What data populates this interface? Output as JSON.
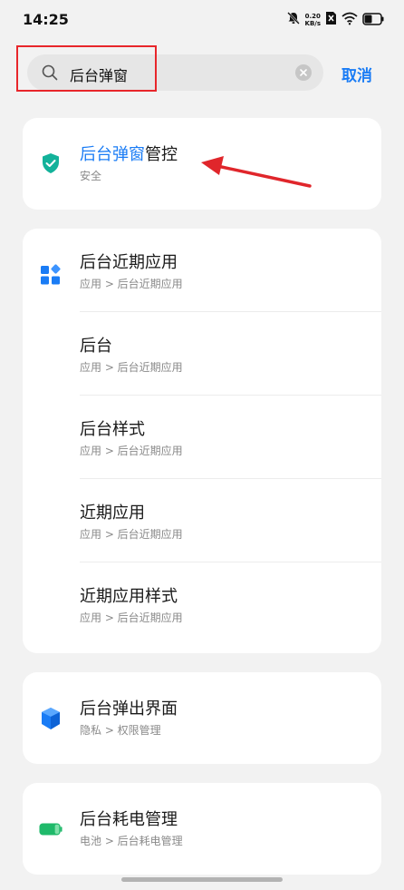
{
  "status_bar": {
    "time": "14:25",
    "net_speed_value": "0.20",
    "net_speed_unit": "KB/s",
    "icons": [
      "bell-off-icon",
      "net-speed",
      "sim-icon",
      "wifi-icon",
      "battery-icon"
    ]
  },
  "search": {
    "query": "后台弹窗",
    "clear_icon": "clear-icon",
    "cancel_label": "取消"
  },
  "results": [
    {
      "title_highlight": "后台弹窗",
      "title_rest": "管控",
      "subtitle": "安全",
      "icon": "shield-check-icon",
      "icon_color": "#13b29a"
    },
    {
      "group": [
        {
          "title": "后台近期应用",
          "subtitle": "应用 > 后台近期应用",
          "icon": "apps-grid-icon",
          "icon_color": "#1a7cf5"
        },
        {
          "title": "后台",
          "subtitle": "应用 > 后台近期应用"
        },
        {
          "title": "后台样式",
          "subtitle": "应用 > 后台近期应用"
        },
        {
          "title": "近期应用",
          "subtitle": "应用 > 后台近期应用"
        },
        {
          "title": "近期应用样式",
          "subtitle": "应用 > 后台近期应用"
        }
      ]
    },
    {
      "title": "后台弹出界面",
      "subtitle": "隐私 > 权限管理",
      "icon": "privacy-cube-icon",
      "icon_color": "#1a7cf5"
    },
    {
      "title": "后台耗电管理",
      "subtitle": "电池 > 后台耗电管理",
      "icon": "battery-level-icon",
      "icon_color": "#1fb96a"
    }
  ],
  "annotation": {
    "highlight_color": "#e8262b",
    "arrow_color": "#e0262b"
  },
  "accent_color": "#1a7cf5"
}
